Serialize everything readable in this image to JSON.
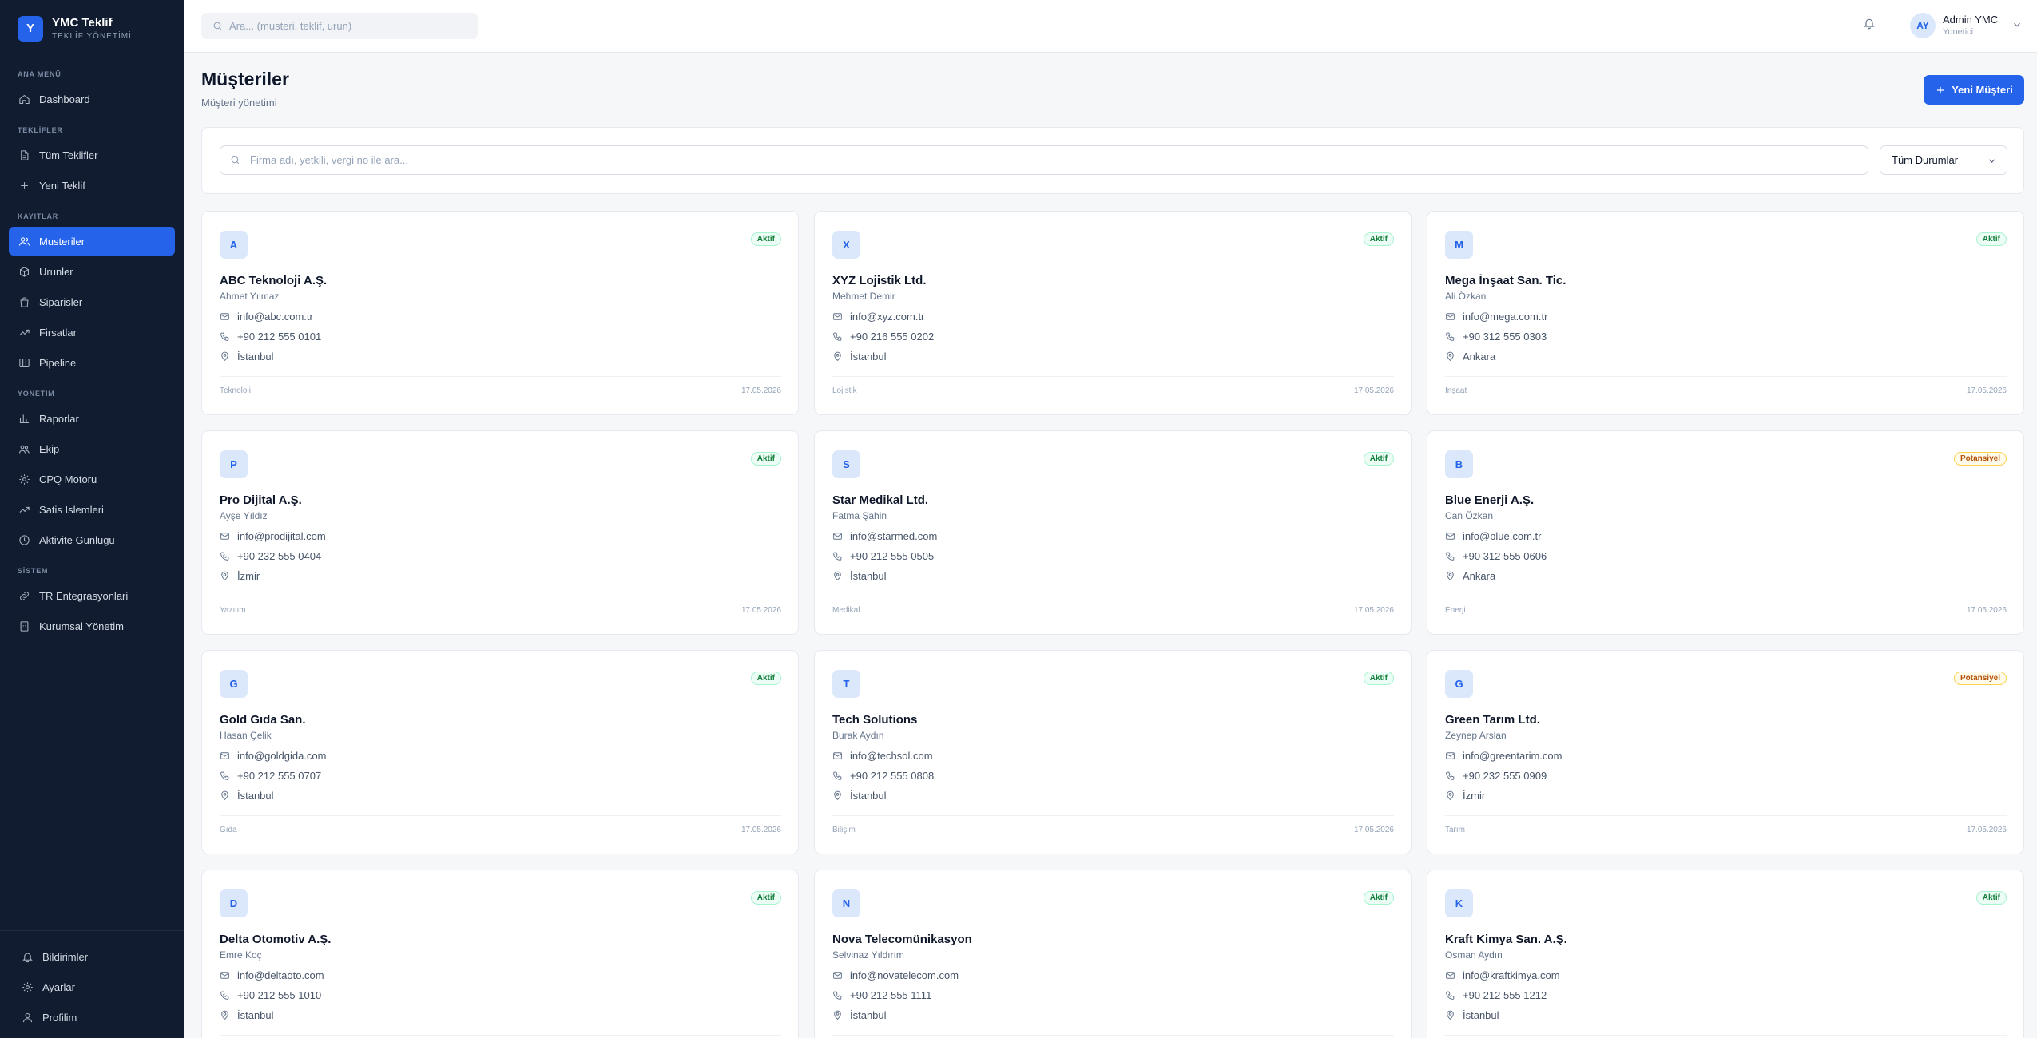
{
  "brand": {
    "logo_letter": "Y",
    "name": "YMC Teklif",
    "subtitle": "TEKLİF YÖNETİMİ"
  },
  "sidebar": {
    "sections": [
      {
        "title": "ANA MENÜ",
        "items": [
          {
            "label": "Dashboard",
            "icon": "home-icon"
          }
        ]
      },
      {
        "title": "TEKLİFLER",
        "items": [
          {
            "label": "Tüm Teklifler",
            "icon": "file-icon"
          },
          {
            "label": "Yeni Teklif",
            "icon": "plus-icon"
          }
        ]
      },
      {
        "title": "KAYITLAR",
        "items": [
          {
            "label": "Musteriler",
            "icon": "users-icon",
            "active": true
          },
          {
            "label": "Urunler",
            "icon": "box-icon"
          },
          {
            "label": "Siparisler",
            "icon": "bag-icon"
          },
          {
            "label": "Firsatlar",
            "icon": "trending-up-icon"
          },
          {
            "label": "Pipeline",
            "icon": "columns-icon"
          }
        ]
      },
      {
        "title": "YÖNETİM",
        "items": [
          {
            "label": "Raporlar",
            "icon": "bar-chart-icon"
          },
          {
            "label": "Ekip",
            "icon": "team-icon"
          },
          {
            "label": "CPQ Motoru",
            "icon": "cog-icon"
          },
          {
            "label": "Satis Islemleri",
            "icon": "trending-up-icon"
          },
          {
            "label": "Aktivite Gunlugu",
            "icon": "clock-icon"
          }
        ]
      },
      {
        "title": "SİSTEM",
        "items": [
          {
            "label": "TR Entegrasyonlari",
            "icon": "link-icon"
          },
          {
            "label": "Kurumsal Yönetim",
            "icon": "building-icon"
          }
        ]
      }
    ],
    "bottom": [
      {
        "label": "Bildirimler",
        "icon": "bell-icon"
      },
      {
        "label": "Ayarlar",
        "icon": "gear-icon"
      },
      {
        "label": "Profilim",
        "icon": "user-icon"
      }
    ]
  },
  "topbar": {
    "search_placeholder": "Ara... (musteri, teklif, urun)",
    "user": {
      "initials": "AY",
      "name": "Admin YMC",
      "role": "Yonetici"
    }
  },
  "page": {
    "title": "Müşteriler",
    "subtitle": "Müşteri yönetimi",
    "new_button": "Yeni Müşteri"
  },
  "filters": {
    "search_placeholder": "Firma adı, yetkili, vergi no ile ara...",
    "status_value": "Tüm Durumlar"
  },
  "customers": [
    {
      "letter": "A",
      "name": "ABC Teknoloji A.Ş.",
      "contact": "Ahmet Yılmaz",
      "email": "info@abc.com.tr",
      "phone": "+90 212 555 0101",
      "city": "İstanbul",
      "sector": "Teknoloji",
      "date": "17.05.2026",
      "status": "Aktif",
      "status_type": "aktif"
    },
    {
      "letter": "X",
      "name": "XYZ Lojistik Ltd.",
      "contact": "Mehmet Demir",
      "email": "info@xyz.com.tr",
      "phone": "+90 216 555 0202",
      "city": "İstanbul",
      "sector": "Lojistik",
      "date": "17.05.2026",
      "status": "Aktif",
      "status_type": "aktif"
    },
    {
      "letter": "M",
      "name": "Mega İnşaat San. Tic.",
      "contact": "Ali Özkan",
      "email": "info@mega.com.tr",
      "phone": "+90 312 555 0303",
      "city": "Ankara",
      "sector": "İnşaat",
      "date": "17.05.2026",
      "status": "Aktif",
      "status_type": "aktif"
    },
    {
      "letter": "P",
      "name": "Pro Dijital A.Ş.",
      "contact": "Ayşe Yıldız",
      "email": "info@prodijital.com",
      "phone": "+90 232 555 0404",
      "city": "İzmir",
      "sector": "Yazılım",
      "date": "17.05.2026",
      "status": "Aktif",
      "status_type": "aktif"
    },
    {
      "letter": "S",
      "name": "Star Medikal Ltd.",
      "contact": "Fatma Şahin",
      "email": "info@starmed.com",
      "phone": "+90 212 555 0505",
      "city": "İstanbul",
      "sector": "Medikal",
      "date": "17.05.2026",
      "status": "Aktif",
      "status_type": "aktif"
    },
    {
      "letter": "B",
      "name": "Blue Enerji A.Ş.",
      "contact": "Can Özkan",
      "email": "info@blue.com.tr",
      "phone": "+90 312 555 0606",
      "city": "Ankara",
      "sector": "Enerji",
      "date": "17.05.2026",
      "status": "Potansiyel",
      "status_type": "potansiyel"
    },
    {
      "letter": "G",
      "name": "Gold Gıda San.",
      "contact": "Hasan Çelik",
      "email": "info@goldgida.com",
      "phone": "+90 212 555 0707",
      "city": "İstanbul",
      "sector": "Gıda",
      "date": "17.05.2026",
      "status": "Aktif",
      "status_type": "aktif"
    },
    {
      "letter": "T",
      "name": "Tech Solutions",
      "contact": "Burak Aydın",
      "email": "info@techsol.com",
      "phone": "+90 212 555 0808",
      "city": "İstanbul",
      "sector": "Bilişim",
      "date": "17.05.2026",
      "status": "Aktif",
      "status_type": "aktif"
    },
    {
      "letter": "G",
      "name": "Green Tarım Ltd.",
      "contact": "Zeynep Arslan",
      "email": "info@greentarim.com",
      "phone": "+90 232 555 0909",
      "city": "İzmir",
      "sector": "Tarım",
      "date": "17.05.2026",
      "status": "Potansiyel",
      "status_type": "potansiyel"
    },
    {
      "letter": "D",
      "name": "Delta Otomotiv A.Ş.",
      "contact": "Emre Koç",
      "email": "info@deltaoto.com",
      "phone": "+90 212 555 1010",
      "city": "İstanbul",
      "sector": "",
      "date": "",
      "status": "Aktif",
      "status_type": "aktif"
    },
    {
      "letter": "N",
      "name": "Nova Telecomünikasyon",
      "contact": "Selvinaz Yıldırım",
      "email": "info@novatelecom.com",
      "phone": "+90 212 555 1111",
      "city": "İstanbul",
      "sector": "",
      "date": "",
      "status": "Aktif",
      "status_type": "aktif"
    },
    {
      "letter": "K",
      "name": "Kraft Kimya San. A.Ş.",
      "contact": "Osman Aydın",
      "email": "info@kraftkimya.com",
      "phone": "+90 212 555 1212",
      "city": "İstanbul",
      "sector": "",
      "date": "",
      "status": "Aktif",
      "status_type": "aktif"
    }
  ]
}
